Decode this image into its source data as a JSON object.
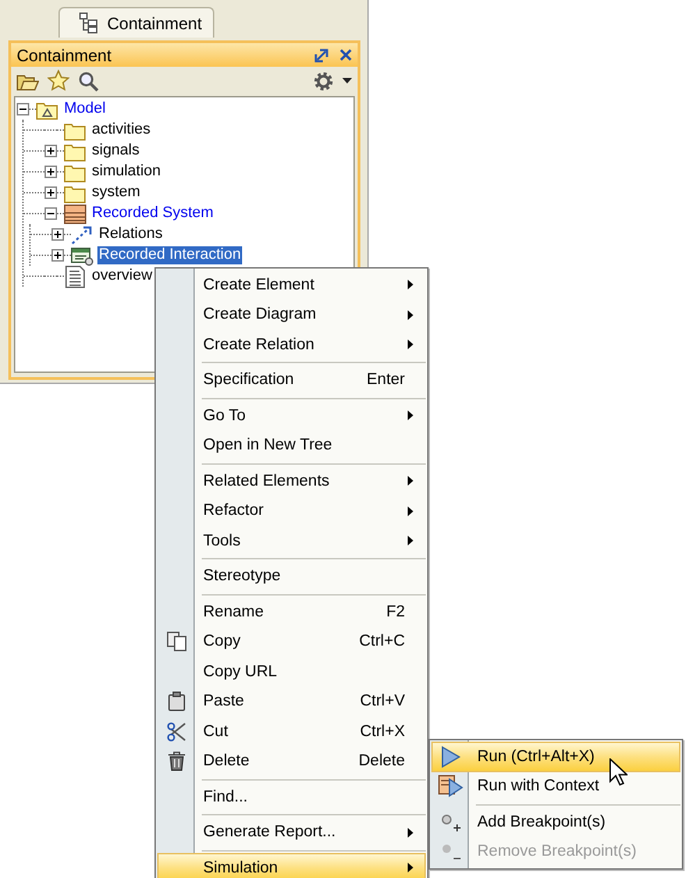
{
  "tab": {
    "label": "Containment"
  },
  "panel": {
    "title": "Containment"
  },
  "tree": [
    {
      "label": "Model",
      "kind": "model",
      "expanded": true,
      "selected": false,
      "children": [
        {
          "label": "activities",
          "kind": "folder",
          "selected": false
        },
        {
          "label": "signals",
          "kind": "folder",
          "expanded": false,
          "selected": false
        },
        {
          "label": "simulation",
          "kind": "folder",
          "expanded": false,
          "selected": false
        },
        {
          "label": "system",
          "kind": "folder",
          "expanded": false,
          "selected": false
        },
        {
          "label": "Recorded System",
          "kind": "block",
          "expanded": true,
          "selected": false,
          "children": [
            {
              "label": "Relations",
              "kind": "relations",
              "expanded": false,
              "selected": false
            },
            {
              "label": "Recorded Interaction",
              "kind": "interaction",
              "expanded": false,
              "selected": true
            }
          ]
        },
        {
          "label": "overview",
          "kind": "diagram",
          "selected": false
        }
      ]
    }
  ],
  "context_menu": {
    "groups": [
      {
        "items": [
          {
            "label": "Create Element",
            "submenu": true,
            "selected": false
          },
          {
            "label": "Create Diagram",
            "submenu": true,
            "selected": false
          },
          {
            "label": "Create Relation",
            "submenu": true,
            "selected": false
          }
        ]
      },
      {
        "items": [
          {
            "label": "Specification",
            "shortcut": "Enter",
            "submenu": false,
            "selected": false
          }
        ]
      },
      {
        "items": [
          {
            "label": "Go To",
            "submenu": true,
            "selected": false
          },
          {
            "label": "Open in New Tree",
            "submenu": false,
            "selected": false
          }
        ]
      },
      {
        "items": [
          {
            "label": "Related Elements",
            "submenu": true,
            "selected": false
          },
          {
            "label": "Refactor",
            "submenu": true,
            "selected": false
          },
          {
            "label": "Tools",
            "submenu": true,
            "selected": false
          }
        ]
      },
      {
        "items": [
          {
            "label": "Stereotype",
            "submenu": false,
            "selected": false
          }
        ]
      },
      {
        "items": [
          {
            "label": "Rename",
            "shortcut": "F2",
            "submenu": false,
            "selected": false
          },
          {
            "label": "Copy",
            "shortcut": "Ctrl+C",
            "kind": "copy",
            "submenu": false,
            "selected": false
          },
          {
            "label": "Copy URL",
            "submenu": false,
            "selected": false
          },
          {
            "label": "Paste",
            "shortcut": "Ctrl+V",
            "kind": "paste",
            "submenu": false,
            "selected": false
          },
          {
            "label": "Cut",
            "shortcut": "Ctrl+X",
            "kind": "cut",
            "submenu": false,
            "selected": false
          },
          {
            "label": "Delete",
            "shortcut": "Delete",
            "kind": "delete",
            "submenu": false,
            "selected": false
          }
        ]
      },
      {
        "items": [
          {
            "label": "Find...",
            "submenu": false,
            "selected": false
          }
        ]
      },
      {
        "items": [
          {
            "label": "Generate Report...",
            "submenu": true,
            "selected": false
          }
        ]
      },
      {
        "items": [
          {
            "label": "Simulation",
            "submenu": true,
            "selected": true
          }
        ]
      }
    ]
  },
  "submenu": {
    "groups": [
      {
        "items": [
          {
            "label": "Run (Ctrl+Alt+X)",
            "kind": "run",
            "selected": true,
            "disabled": false
          },
          {
            "label": "Run with Context",
            "kind": "run-context",
            "selected": false,
            "disabled": false
          }
        ]
      },
      {
        "items": [
          {
            "label": "Add Breakpoint(s)",
            "kind": "add-breakpoint",
            "selected": false,
            "disabled": false
          },
          {
            "label": "Remove Breakpoint(s)",
            "kind": "remove-breakpoint",
            "selected": false,
            "disabled": true
          }
        ]
      }
    ]
  }
}
